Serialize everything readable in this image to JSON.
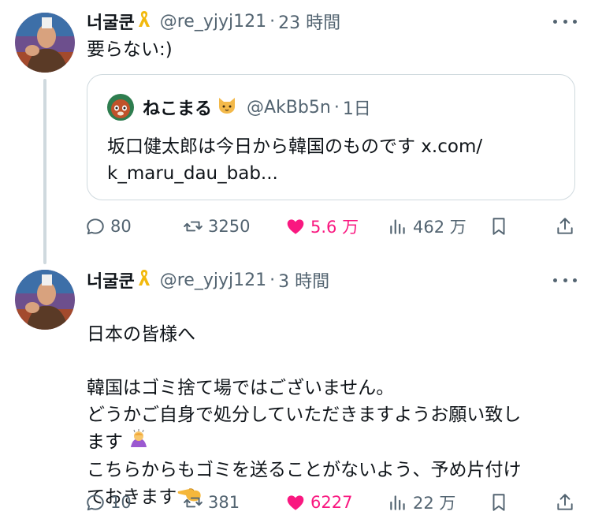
{
  "tweets": [
    {
      "display_name": "너굴쿤",
      "handle": "@re_yjyj121",
      "separator": "·",
      "time": "23 時間",
      "text": "要らない:)",
      "quote": {
        "display_name": "ねこまる",
        "handle": "@AkBb5n",
        "separator": "·",
        "time": "1日",
        "text": "坂口健太郎は今日から韓国のものです x.com/\nk_maru_dau_bab..."
      },
      "actions": {
        "replies": "80",
        "retweets": "3250",
        "likes": "5.6 万",
        "views": "462 万"
      }
    },
    {
      "display_name": "너굴쿤",
      "handle": "@re_yjyj121",
      "separator": "·",
      "time": "3 時間",
      "text_lines": {
        "l1": "日本の皆様へ",
        "l2": "韓国はゴミ捨て場ではございません。",
        "l3": "どうかご自身で処分していただきますようお願い致し",
        "l4": "ます",
        "l5": "こちらからもゴミを送ることがないよう、予め片付け",
        "l6": "ておきます"
      },
      "actions": {
        "replies": "10",
        "retweets": "381",
        "likes": "6227",
        "views": "22 万"
      }
    }
  ],
  "icons": {
    "ribbon": "yellow-ribbon-icon",
    "cat": "cat-face-icon",
    "reply": "reply-icon",
    "retweet": "retweet-icon",
    "like": "heart-icon",
    "views": "views-icon",
    "bookmark": "bookmark-icon",
    "share": "share-icon"
  },
  "colors": {
    "like": "#f91880",
    "secondary": "#536471",
    "border": "#cfd9de"
  }
}
